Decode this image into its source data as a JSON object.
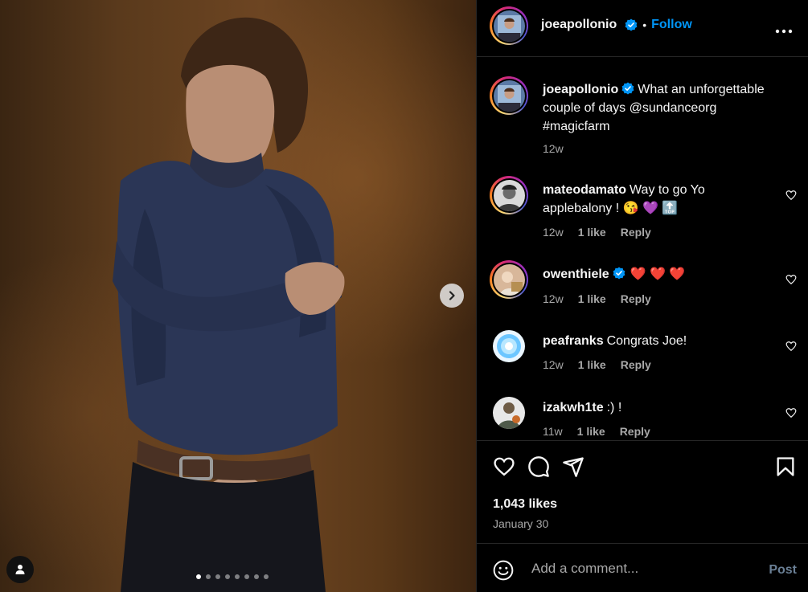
{
  "header": {
    "username": "joeapollonio",
    "separator": "•",
    "follow_label": "Follow",
    "more_icon": "more-horizontal-icon"
  },
  "caption": {
    "username": "joeapollonio",
    "text": "What an unforgettable couple of days @sundanceorg #magicfarm",
    "time": "12w"
  },
  "comments": [
    {
      "username": "mateodamato",
      "text": "Way to go Yo applebalony ! 😘 💜 🔝",
      "time": "12w",
      "likes": "1 like",
      "reply": "Reply"
    },
    {
      "username": "owenthiele",
      "text": "❤️ ❤️ ❤️",
      "time": "12w",
      "likes": "1 like",
      "reply": "Reply"
    },
    {
      "username": "peafranks",
      "text": "Congrats Joe!",
      "time": "12w",
      "likes": "1 like",
      "reply": "Reply"
    },
    {
      "username": "izakwh1te",
      "text": ":) !",
      "time": "11w",
      "likes": "1 like",
      "reply": "Reply"
    }
  ],
  "stats": {
    "likes": "1,043 likes",
    "date": "January 30"
  },
  "composer": {
    "placeholder": "Add a comment...",
    "post_label": "Post"
  },
  "carousel": {
    "slide_count": 8,
    "active_index": 0
  },
  "colors": {
    "accent": "#0095f6",
    "background": "#000000",
    "muted": "#a8a8a8",
    "heart_red": "#ff3040"
  }
}
